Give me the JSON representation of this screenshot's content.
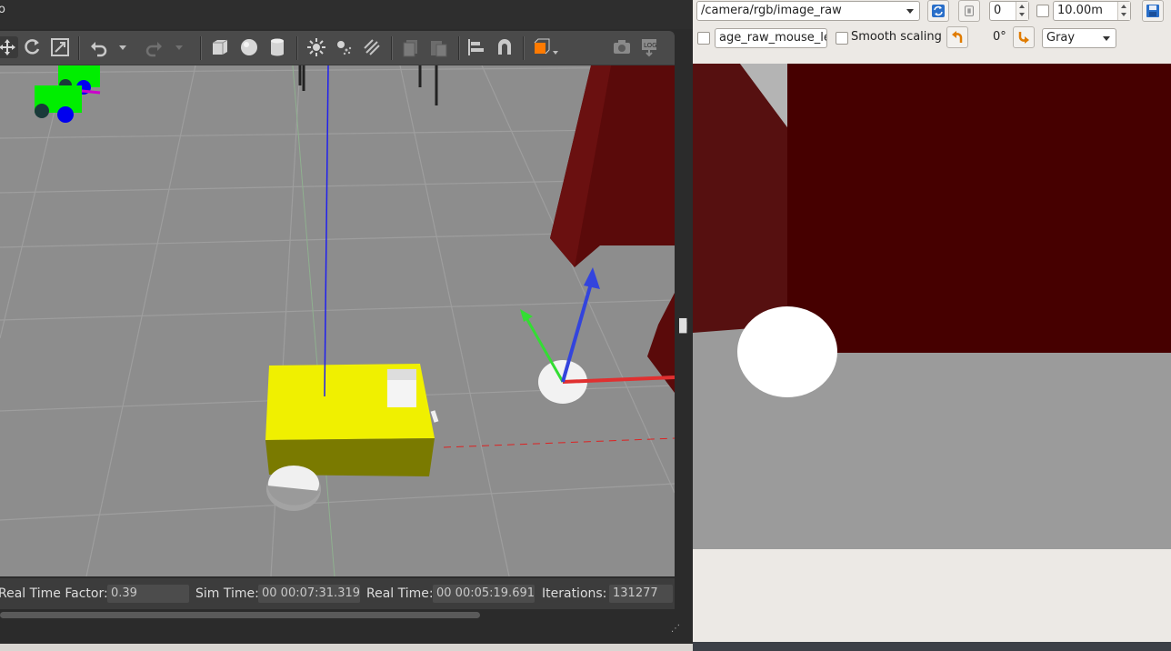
{
  "gazebo": {
    "title_fragment": "o",
    "toolbar_icons": [
      "translate-icon",
      "rotate-icon",
      "scale-icon",
      "undo-icon",
      "undo-dropdown-icon",
      "redo-icon",
      "redo-dropdown-icon",
      "box-icon",
      "sphere-icon",
      "cylinder-icon",
      "point-light-icon",
      "spot-light-icon",
      "directional-light-icon",
      "copy-icon",
      "paste-icon",
      "align-icon",
      "snap-icon",
      "view-angle-icon",
      "screenshot-icon",
      "log-icon"
    ],
    "status": {
      "real_time_factor_label": "Real Time Factor:",
      "real_time_factor": "0.39",
      "sim_time_label": "Sim Time:",
      "sim_time": "00 00:07:31.319",
      "real_time_label": "Real Time:",
      "real_time": "00 00:05:19.691",
      "iterations_label": "Iterations:",
      "iterations": "131277"
    },
    "colors": {
      "ground": "#8c8c8c",
      "robot_body": "#ffff00",
      "wall": "#5a0a0a"
    }
  },
  "image_view": {
    "topic": "/camera/rgb/image_raw",
    "min_value": "0",
    "max_range": "10.00m",
    "mouse_topic": "age_raw_mouse_left",
    "smooth_scaling_label": "Smooth scaling",
    "rotation": "0°",
    "color_scheme": "Gray",
    "colors": {
      "wall_dark": "#460000",
      "floor": "#9b9b9b"
    }
  }
}
